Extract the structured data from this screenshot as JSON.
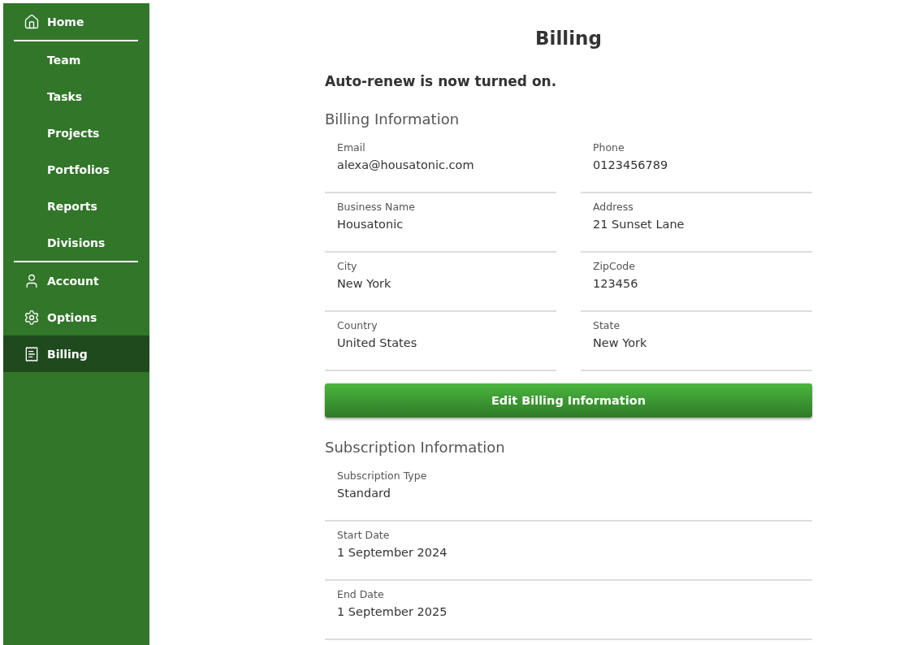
{
  "sidebar": {
    "sections": [
      [
        {
          "label": "Home",
          "selected": false
        }
      ],
      [
        {
          "label": "Team",
          "selected": false
        },
        {
          "label": "Tasks",
          "selected": false
        },
        {
          "label": "Projects",
          "selected": false
        },
        {
          "label": "Portfolios",
          "selected": false
        },
        {
          "label": "Reports",
          "selected": false
        },
        {
          "label": "Divisions",
          "selected": false
        }
      ],
      [
        {
          "label": "Account",
          "selected": false
        },
        {
          "label": "Options",
          "selected": false
        },
        {
          "label": "Billing",
          "selected": true
        }
      ]
    ]
  },
  "title": "Billing",
  "notice": "Auto-renew is now turned on.",
  "billing": {
    "heading": "Billing Information",
    "fields": [
      {
        "label": "Email",
        "value": "alexa@housatonic.com"
      },
      {
        "label": "Phone",
        "value": "0123456789"
      },
      {
        "label": "Business Name",
        "value": "Housatonic"
      },
      {
        "label": "Address",
        "value": "21 Sunset Lane"
      },
      {
        "label": "City",
        "value": "New York"
      },
      {
        "label": "ZipCode",
        "value": "123456"
      },
      {
        "label": "Country",
        "value": "United States"
      },
      {
        "label": "State",
        "value": "New York"
      }
    ],
    "button": "Edit Billing Information"
  },
  "subscription": {
    "heading": "Subscription Information",
    "fields": [
      {
        "label": "Subscription Type",
        "value": "Standard"
      },
      {
        "label": "Start Date",
        "value": "1 September 2024"
      },
      {
        "label": "End Date",
        "value": "1 September 2025"
      }
    ]
  }
}
